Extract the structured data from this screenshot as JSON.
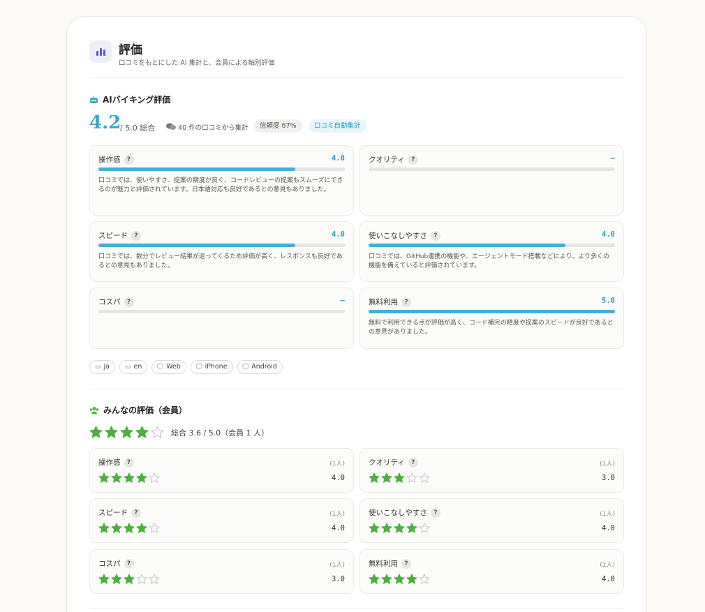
{
  "header": {
    "title": "評価",
    "subtitle": "口コミをもとにした AI 集計と、会員による軸別評価"
  },
  "ai": {
    "section_title": "AIバイキング評価",
    "score": "4.2",
    "out_of": "/ 5.0 総合",
    "reviews_meta": "40 件の口コミから集計",
    "confidence": "信頼度 67%",
    "auto_label": "口コミ自動集計",
    "help_mark": "?",
    "items": [
      {
        "name": "操作感",
        "value": "4.0",
        "progress": 0.8,
        "desc": "口コミでは、使いやすさ、提案の精度が良く、コードレビューの提案もスムーズにできるのが魅力と評価されています。日本語対応も良好であるとの意見もありました。"
      },
      {
        "name": "クオリティ",
        "value": "–",
        "progress": 0,
        "desc": ""
      },
      {
        "name": "スピード",
        "value": "4.0",
        "progress": 0.8,
        "desc": "口コミでは、数分でレビュー結果が返ってくるため評価が高く、レスポンスも良好であるとの意見もありました。"
      },
      {
        "name": "使いこなしやすさ",
        "value": "4.0",
        "progress": 0.8,
        "desc": "口コミでは、GitHub連携の機能や、エージェントモード搭載などにより、より多くの機能を備えていると評価されています。"
      },
      {
        "name": "コスパ",
        "value": "–",
        "progress": 0,
        "desc": ""
      },
      {
        "name": "無料利用",
        "value": "5.0",
        "progress": 1.0,
        "desc": "無料で利用できる点が評価が高く、コード補完の精度や提案のスピードが良好であるとの意見がありました。"
      }
    ],
    "tags": [
      {
        "icon": "language-icon",
        "label": "ja"
      },
      {
        "icon": "language-icon",
        "label": "en"
      },
      {
        "icon": "monitor-icon",
        "label": "Web"
      },
      {
        "icon": "monitor-icon",
        "label": "iPhone"
      },
      {
        "icon": "monitor-icon",
        "label": "Android"
      }
    ]
  },
  "members": {
    "section_title": "みんなの評価（会員）",
    "overall_stars": 4,
    "summary": "総合 3.6 / 5.0（会員 1 人）",
    "items": [
      {
        "name": "操作感",
        "count": "(1人)",
        "stars": 4,
        "value": "4.0"
      },
      {
        "name": "クオリティ",
        "count": "(1人)",
        "stars": 3,
        "value": "3.0"
      },
      {
        "name": "スピード",
        "count": "(1人)",
        "stars": 4,
        "value": "4.0"
      },
      {
        "name": "使いこなしやすさ",
        "count": "(1人)",
        "stars": 4,
        "value": "4.0"
      },
      {
        "name": "コスパ",
        "count": "(1人)",
        "stars": 3,
        "value": "3.0"
      },
      {
        "name": "無料利用",
        "count": "(1人)",
        "stars": 4,
        "value": "4.0"
      }
    ]
  },
  "colors": {
    "accent": "#43b0d3",
    "star_on": "#4caf3e",
    "star_off": "#c9c9c9"
  }
}
